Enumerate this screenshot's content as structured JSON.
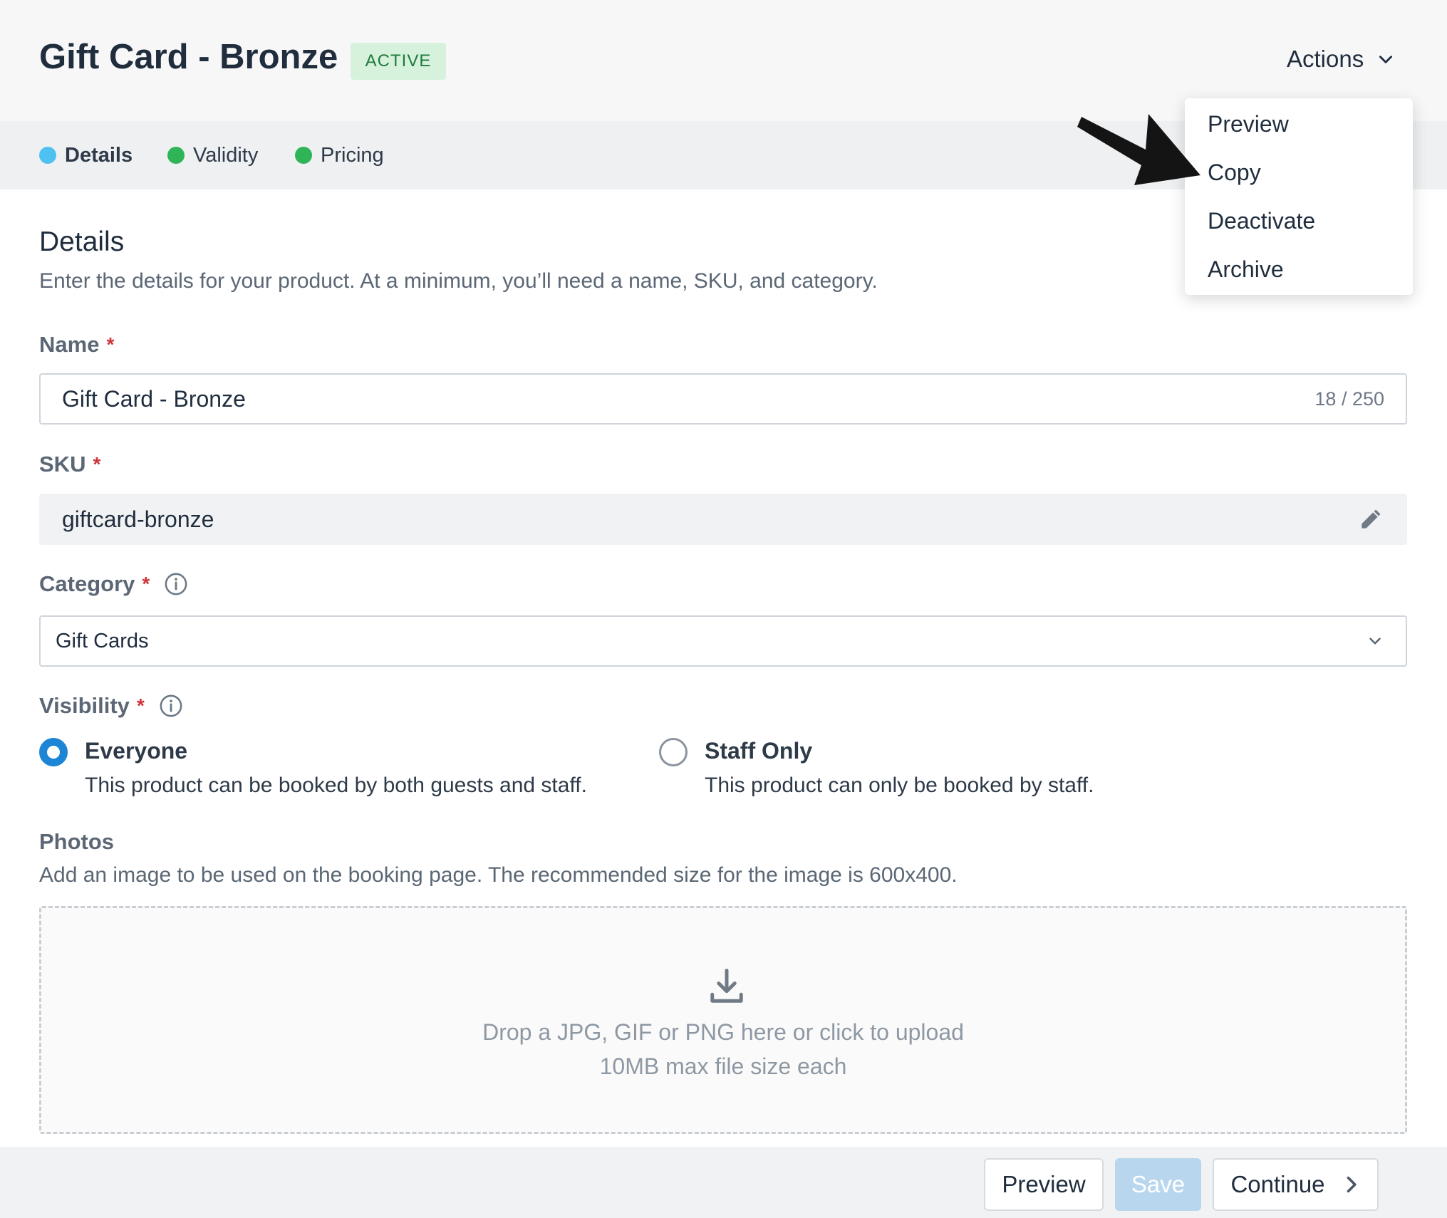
{
  "header": {
    "title": "Gift Card - Bronze",
    "status_badge": "ACTIVE",
    "actions_label": "Actions"
  },
  "steps": [
    {
      "label": "Details",
      "color": "#4fc1f0"
    },
    {
      "label": "Validity",
      "color": "#2fb557"
    },
    {
      "label": "Pricing",
      "color": "#2fb557"
    }
  ],
  "details": {
    "title": "Details",
    "description": "Enter the details for your product. At a minimum, you’ll need a name, SKU, and category."
  },
  "fields": {
    "name": {
      "label": "Name",
      "required": "*",
      "value": "Gift Card - Bronze",
      "counter": "18 / 250"
    },
    "sku": {
      "label": "SKU",
      "required": "*",
      "value": "giftcard-bronze"
    },
    "category": {
      "label": "Category",
      "required": "*",
      "value": "Gift Cards"
    },
    "visibility": {
      "label": "Visibility",
      "required": "*",
      "options": [
        {
          "title": "Everyone",
          "description": "This product can be booked by both guests and staff.",
          "selected": true
        },
        {
          "title": "Staff Only",
          "description": "This product can only be booked by staff.",
          "selected": false
        }
      ]
    }
  },
  "photos": {
    "label": "Photos",
    "description": "Add an image to be used on the booking page. The recommended size for the image is 600x400.",
    "drop_line1": "Drop a JPG, GIF or PNG here or click to upload",
    "drop_line2": "10MB max file size each"
  },
  "actions_menu": {
    "items": [
      "Preview",
      "Copy",
      "Deactivate",
      "Archive"
    ]
  },
  "footer": {
    "preview_label": "Preview",
    "save_label": "Save",
    "continue_label": "Continue"
  },
  "colors": {
    "accent": "#1c85d6",
    "active_badge_bg": "#d6f2dd",
    "required": "#d0353b"
  }
}
